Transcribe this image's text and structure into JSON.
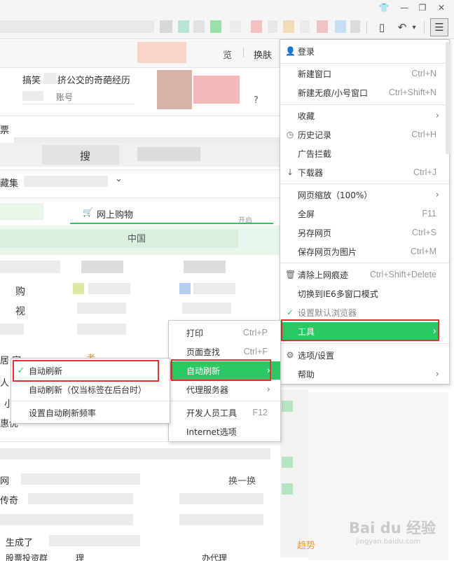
{
  "toolbar": {
    "icons": {
      "skin": "tshirt-icon",
      "minimize": "minimize-icon",
      "restore": "restore-icon",
      "close": "close-icon",
      "phone": "mobile-icon",
      "undo": "undo-icon",
      "menu": "hamburger-icon"
    },
    "glyphs": {
      "skin": "👕",
      "minimize": "—",
      "restore": "❐",
      "close": "✕",
      "phone": "▯",
      "undo": "↶",
      "undo_dropdown": "▾",
      "menu": "☰"
    }
  },
  "page": {
    "skin_link": "换肤",
    "mid_link": "览",
    "headline": "搞笑",
    "headline_tail": "挤公交的奇葩经历",
    "account_label": "账号",
    "question_mark": "?",
    "ticket": "票",
    "search_char": "搜",
    "collection": "藏集",
    "dropdown": "⌄",
    "shopping": "网上购物",
    "enable": "开启",
    "china": "中国",
    "buy": "购",
    "video": "视",
    "home": "居 家",
    "person": "人",
    "small": "小",
    "special": "惠优",
    "lao": "老",
    "network": "网",
    "legend": "传奇",
    "refresh_batch": "换一换",
    "bottom1": "生成了",
    "bottom2": "股票投资群",
    "bottom3": "理",
    "bottom4": "办代理",
    "watermark": "Bai du 经验",
    "watermark_url": "jingyan.baidu.com",
    "trend": "趋势"
  },
  "main_menu": {
    "items": [
      {
        "label": "登录",
        "icon": "user-icon",
        "glyph": "👤"
      },
      {
        "label": "新建窗口",
        "shortcut": "Ctrl+N"
      },
      {
        "label": "新建无痕/小号窗口",
        "shortcut": "Ctrl+Shift+N"
      },
      {
        "label": "收藏",
        "arrow": "›"
      },
      {
        "label": "历史记录",
        "shortcut": "Ctrl+H",
        "icon": "clock-icon",
        "glyph": "◷"
      },
      {
        "label": "广告拦截"
      },
      {
        "label": "下载器",
        "shortcut": "Ctrl+J",
        "icon": "download-icon",
        "glyph": "↓"
      },
      {
        "label": "网页缩放（100%）",
        "arrow": "›"
      },
      {
        "label": "全屏",
        "shortcut": "F11"
      },
      {
        "label": "另存网页",
        "shortcut": "Ctrl+S"
      },
      {
        "label": "保存网页为图片",
        "shortcut": "Ctrl+M"
      },
      {
        "label": "清除上网痕迹",
        "shortcut": "Ctrl+Shift+Delete",
        "icon": "trash-icon",
        "glyph": "🗑"
      },
      {
        "label": "切换到IE6多窗口模式"
      },
      {
        "label": "设置默认浏览器",
        "icon": "check-icon",
        "glyph": "✓"
      },
      {
        "label": "工具",
        "arrow": "›"
      },
      {
        "label": "选项/设置",
        "icon": "gear-icon",
        "glyph": "⚙"
      },
      {
        "label": "帮助",
        "arrow": "›"
      }
    ]
  },
  "tools_menu": {
    "items": [
      {
        "label": "打印",
        "shortcut": "Ctrl+P"
      },
      {
        "label": "页面查找",
        "shortcut": "Ctrl+F"
      },
      {
        "label": "自动刷新",
        "arrow": "›"
      },
      {
        "label": "代理服务器",
        "arrow": "›"
      },
      {
        "label": "开发人员工具",
        "shortcut": "F12"
      },
      {
        "label": "Internet选项"
      }
    ]
  },
  "refresh_menu": {
    "items": [
      {
        "label": "自动刷新",
        "icon": "check-icon",
        "glyph": "✓"
      },
      {
        "label": "自动刷新（仅当标签在后台时）"
      },
      {
        "label": "设置自动刷新频率"
      }
    ]
  },
  "colors": {
    "highlight": "#2cc865",
    "annotation_red": "#e03434",
    "check_green": "#2cc865"
  }
}
